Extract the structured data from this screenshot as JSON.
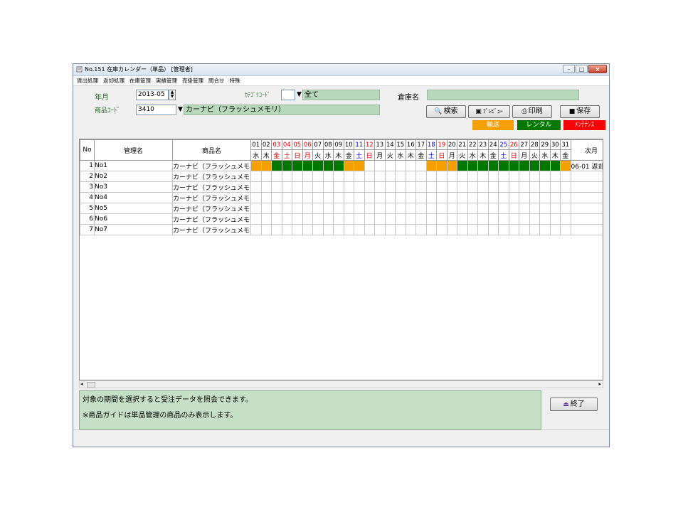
{
  "window": {
    "title": "No.151 在庫カレンダー（単品） [管理者]"
  },
  "menu": [
    "賃出処理",
    "返却処理",
    "在庫管理",
    "実績管理",
    "売掛管理",
    "問合せ",
    "特殊"
  ],
  "form": {
    "year_month_label": "年月",
    "year_month_value": "2013-05",
    "category_label": "ｶﾃｺﾞﾘｺｰﾄﾞ",
    "category_value": "",
    "category_name": "全て",
    "warehouse_label": "倉庫名",
    "warehouse_value": "",
    "product_code_label": "商品ｺｰﾄﾞ",
    "product_code_value": "3410",
    "product_name": "カーナビ（フラッシュメモリ）"
  },
  "buttons": {
    "search": "検索",
    "preview": "ﾌﾟﾚﾋﾞｭｰ",
    "print": "印刷",
    "save": "保存",
    "exit": "終了"
  },
  "legend": {
    "transport": {
      "label": "輸送",
      "color": "#f5a000"
    },
    "rental": {
      "label": "レンタル",
      "color": "#007800"
    },
    "maintenance": {
      "label": "ﾒﾝﾃﾅﾝｽ",
      "color": "#ff0000"
    }
  },
  "grid": {
    "headers": {
      "no": "No",
      "manager": "管理名",
      "product": "商品名",
      "next": "次月"
    },
    "days": [
      {
        "d": "01",
        "w": "水",
        "c": "#000000"
      },
      {
        "d": "02",
        "w": "木",
        "c": "#000000"
      },
      {
        "d": "03",
        "w": "金",
        "c": "#e00000"
      },
      {
        "d": "04",
        "w": "土",
        "c": "#e00000"
      },
      {
        "d": "05",
        "w": "日",
        "c": "#e00000"
      },
      {
        "d": "06",
        "w": "月",
        "c": "#e00000"
      },
      {
        "d": "07",
        "w": "火",
        "c": "#000000"
      },
      {
        "d": "08",
        "w": "水",
        "c": "#000000"
      },
      {
        "d": "09",
        "w": "木",
        "c": "#000000"
      },
      {
        "d": "10",
        "w": "金",
        "c": "#000000"
      },
      {
        "d": "11",
        "w": "土",
        "c": "#0000e0"
      },
      {
        "d": "12",
        "w": "日",
        "c": "#e00000"
      },
      {
        "d": "13",
        "w": "月",
        "c": "#000000"
      },
      {
        "d": "14",
        "w": "火",
        "c": "#000000"
      },
      {
        "d": "15",
        "w": "水",
        "c": "#000000"
      },
      {
        "d": "16",
        "w": "木",
        "c": "#000000"
      },
      {
        "d": "17",
        "w": "金",
        "c": "#000000"
      },
      {
        "d": "18",
        "w": "土",
        "c": "#0000e0"
      },
      {
        "d": "19",
        "w": "日",
        "c": "#e00000"
      },
      {
        "d": "20",
        "w": "月",
        "c": "#000000"
      },
      {
        "d": "21",
        "w": "火",
        "c": "#000000"
      },
      {
        "d": "22",
        "w": "水",
        "c": "#000000"
      },
      {
        "d": "23",
        "w": "木",
        "c": "#000000"
      },
      {
        "d": "24",
        "w": "金",
        "c": "#000000"
      },
      {
        "d": "25",
        "w": "土",
        "c": "#0000e0"
      },
      {
        "d": "26",
        "w": "日",
        "c": "#e00000"
      },
      {
        "d": "27",
        "w": "月",
        "c": "#000000"
      },
      {
        "d": "28",
        "w": "火",
        "c": "#000000"
      },
      {
        "d": "29",
        "w": "水",
        "c": "#000000"
      },
      {
        "d": "30",
        "w": "木",
        "c": "#000000"
      },
      {
        "d": "31",
        "w": "金",
        "c": "#000000"
      }
    ],
    "rows": [
      {
        "no": "1",
        "manager": "No1",
        "product": "カーナビ（フラッシュメモリ）",
        "next": "06-01 返却",
        "cells": [
          "t",
          "t",
          "r",
          "r",
          "r",
          "r",
          "r",
          "r",
          "r",
          "t",
          "t",
          "",
          "",
          "",
          "",
          "",
          "",
          "t",
          "t",
          "t",
          "r",
          "r",
          "r",
          "r",
          "r",
          "r",
          "r",
          "r",
          "r",
          "r",
          "t"
        ]
      },
      {
        "no": "2",
        "manager": "No2",
        "product": "カーナビ（フラッシュメモリ）",
        "next": "",
        "cells": []
      },
      {
        "no": "3",
        "manager": "No3",
        "product": "カーナビ（フラッシュメモリ）",
        "next": "",
        "cells": []
      },
      {
        "no": "4",
        "manager": "No4",
        "product": "カーナビ（フラッシュメモリ）",
        "next": "",
        "cells": []
      },
      {
        "no": "5",
        "manager": "No5",
        "product": "カーナビ（フラッシュメモリ）",
        "next": "",
        "cells": []
      },
      {
        "no": "6",
        "manager": "No6",
        "product": "カーナビ（フラッシュメモリ）",
        "next": "",
        "cells": []
      },
      {
        "no": "7",
        "manager": "No7",
        "product": "カーナビ（フラッシュメモリ）",
        "next": "",
        "cells": []
      }
    ]
  },
  "messages": [
    "対象の期間を選択すると受注データを照会できます。",
    "※商品ガイドは単品管理の商品のみ表示します。"
  ]
}
